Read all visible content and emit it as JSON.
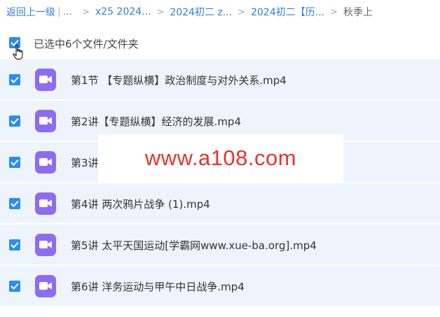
{
  "breadcrumb": {
    "back_label": "返回上一级",
    "pipe": "|",
    "ellipsis": "...",
    "sep": ">",
    "items": [
      "x25 2024...",
      "2024初二 z...",
      "2024初二【历..."
    ],
    "current": "秋季上"
  },
  "selection": {
    "label": "已选中6个文件/文件夹",
    "checked": true
  },
  "files": [
    {
      "name": "第1节 【专题纵横】政治制度与对外关系.mp4",
      "checked": true,
      "type": "video"
    },
    {
      "name": "第2讲【专题纵横】经济的发展.mp4",
      "checked": true,
      "type": "video"
    },
    {
      "name": "第3讲",
      "checked": true,
      "type": "video"
    },
    {
      "name": "第4讲 两次鸦片战争 (1).mp4",
      "checked": true,
      "type": "video"
    },
    {
      "name": "第5讲 太平天国运动[学霸网www.xue-ba.org].mp4",
      "checked": true,
      "type": "video"
    },
    {
      "name": "第6讲 洋务运动与甲午中日战争.mp4",
      "checked": true,
      "type": "video"
    }
  ],
  "watermark": "www.a108.com",
  "colors": {
    "link": "#2b7fd9",
    "checkbox": "#2a8df0",
    "video_icon": "#8d6cf2",
    "row_bg": "#eef4fb",
    "watermark": "#e8322b"
  },
  "icons": {
    "checkbox": "check-icon",
    "file": "video-camera-icon",
    "cursor": "hand-pointer-icon"
  }
}
